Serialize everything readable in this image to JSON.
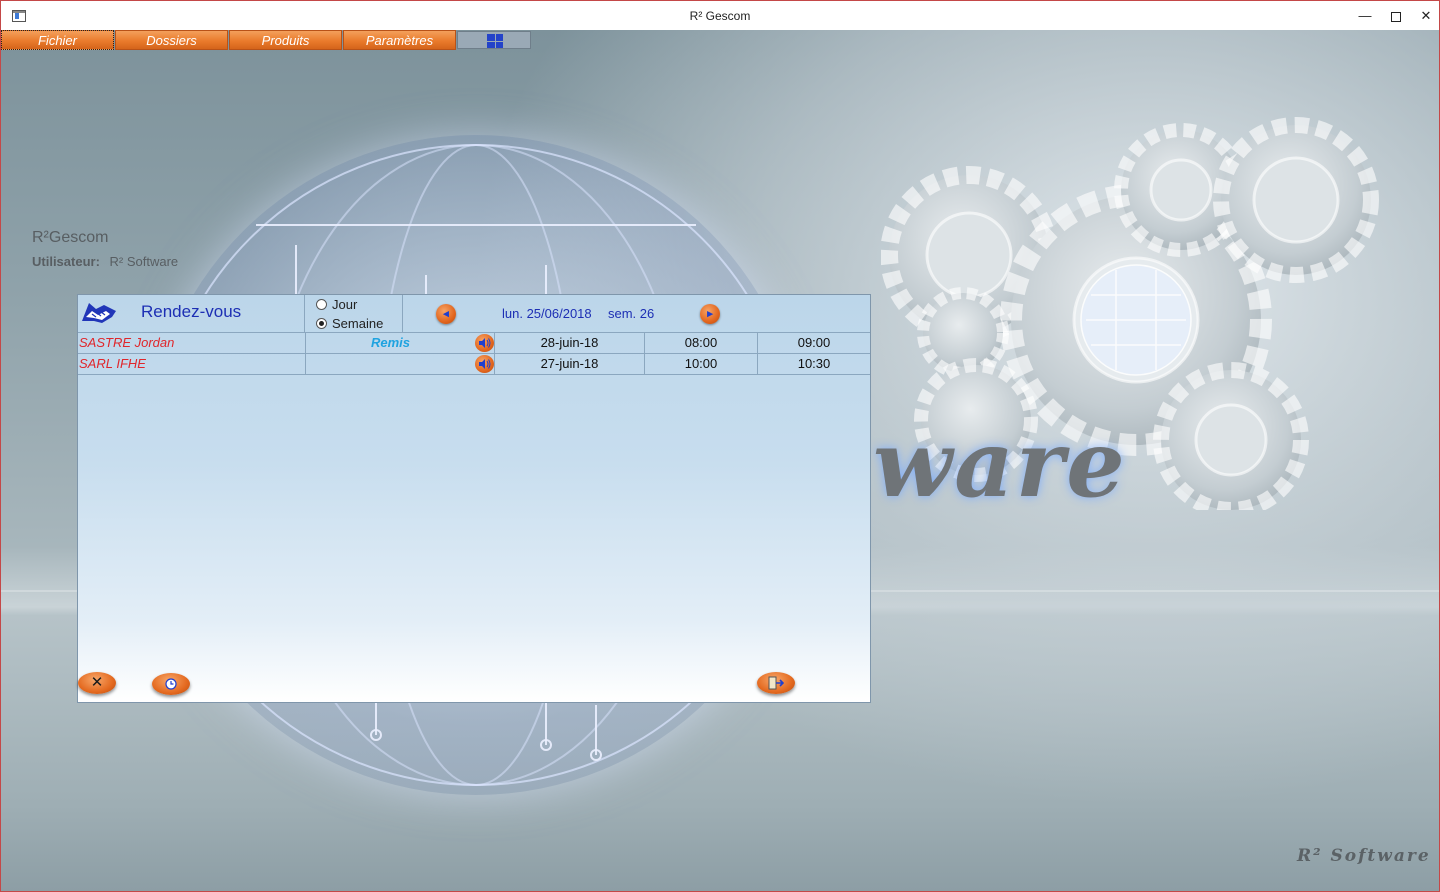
{
  "window": {
    "title": "R² Gescom",
    "minimize_symbol": "—",
    "close_symbol": "✕"
  },
  "menu": {
    "items": [
      {
        "label": "Fichier"
      },
      {
        "label": "Dossiers"
      },
      {
        "label": "Produits"
      },
      {
        "label": "Paramètres"
      }
    ]
  },
  "desktop": {
    "app_name": "R²Gescom",
    "user_label": "Utilisateur:",
    "user_value": "R² Software",
    "watermark": "ware",
    "brand_signature": "R² Software"
  },
  "appointments": {
    "title": "Rendez-vous",
    "view_options": [
      {
        "label": "Jour",
        "selected": false
      },
      {
        "label": "Semaine",
        "selected": true
      }
    ],
    "current_date": "lun. 25/06/2018",
    "week": "sem. 26",
    "rows": [
      {
        "name": "SASTRE Jordan",
        "status": "Remis",
        "date": "28-juin-18",
        "start": "08:00",
        "end": "09:00"
      },
      {
        "name": "SARL IFHE",
        "status": "",
        "date": "27-juin-18",
        "start": "10:00",
        "end": "10:30"
      }
    ]
  },
  "colors": {
    "menu_orange": "#ea7b2c",
    "title_blue": "#1d2fb4",
    "name_red": "#e0262b",
    "status_cyan": "#1fa3e0"
  },
  "icons": {
    "handshake": "handshake-icon",
    "prev": "arrow-left-icon",
    "next": "arrow-right-icon",
    "speaker": "speaker-icon",
    "close": "close-icon",
    "clock": "clock-icon",
    "exit": "exit-door-icon"
  }
}
